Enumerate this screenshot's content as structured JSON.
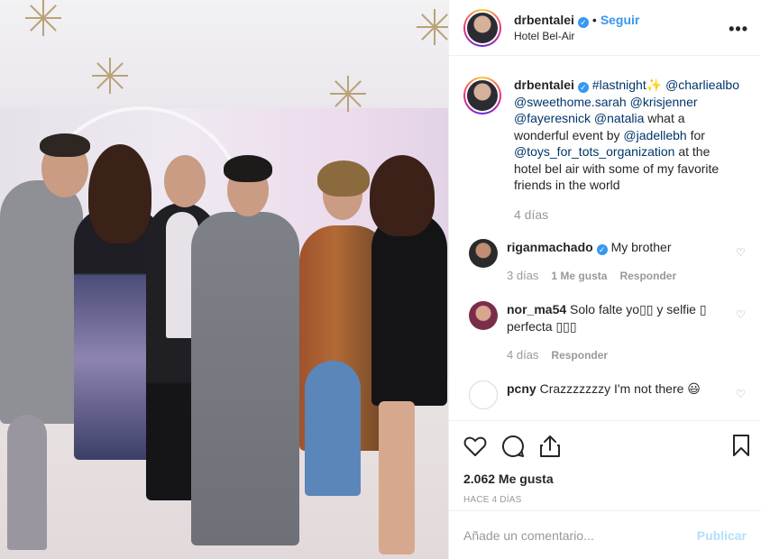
{
  "post": {
    "photo_alt": "Group of seven people posing at an event",
    "header": {
      "username": "drbentalei",
      "follow_label": "Seguir",
      "location": "Hotel Bel-Air",
      "more_label": "•••"
    },
    "caption": {
      "username": "drbentalei",
      "parts": {
        "hashtag": "#lastnight",
        "sparkle": "✨",
        "m1": "@charliealbo",
        "m2": "@sweethome.sarah",
        "m3": "@krisjenner",
        "m4": "@fayeresnick",
        "m5": "@natalia",
        "t1": "what a wonderful event by",
        "m6": "@jadellebh",
        "t2": "for",
        "m7": "@toys_for_tots_organization",
        "t3": "at the hotel bel air with some of my favorite friends in the world"
      },
      "time": "4 días"
    },
    "comments": [
      {
        "username": "riganmachado",
        "text": "My brother",
        "time": "3 días",
        "likes": "1 Me gusta",
        "reply": "Responder"
      },
      {
        "username": "nor_ma54",
        "text": "Solo falte yo▯▯ y selfie ▯ perfecta ▯▯▯",
        "time": "4 días",
        "reply": "Responder"
      },
      {
        "username": "pcny",
        "text": "Crazzzzzzzy I'm not there 😃"
      }
    ],
    "likes_count": "2.062 Me gusta",
    "posted_ago": "HACE 4 DÍAS",
    "add_comment_placeholder": "Añade un comentario...",
    "publish_label": "Publicar"
  },
  "colors": {
    "link": "#003569",
    "accent": "#3897f0",
    "muted": "#999999",
    "publish_disabled": "#b2dffc"
  }
}
